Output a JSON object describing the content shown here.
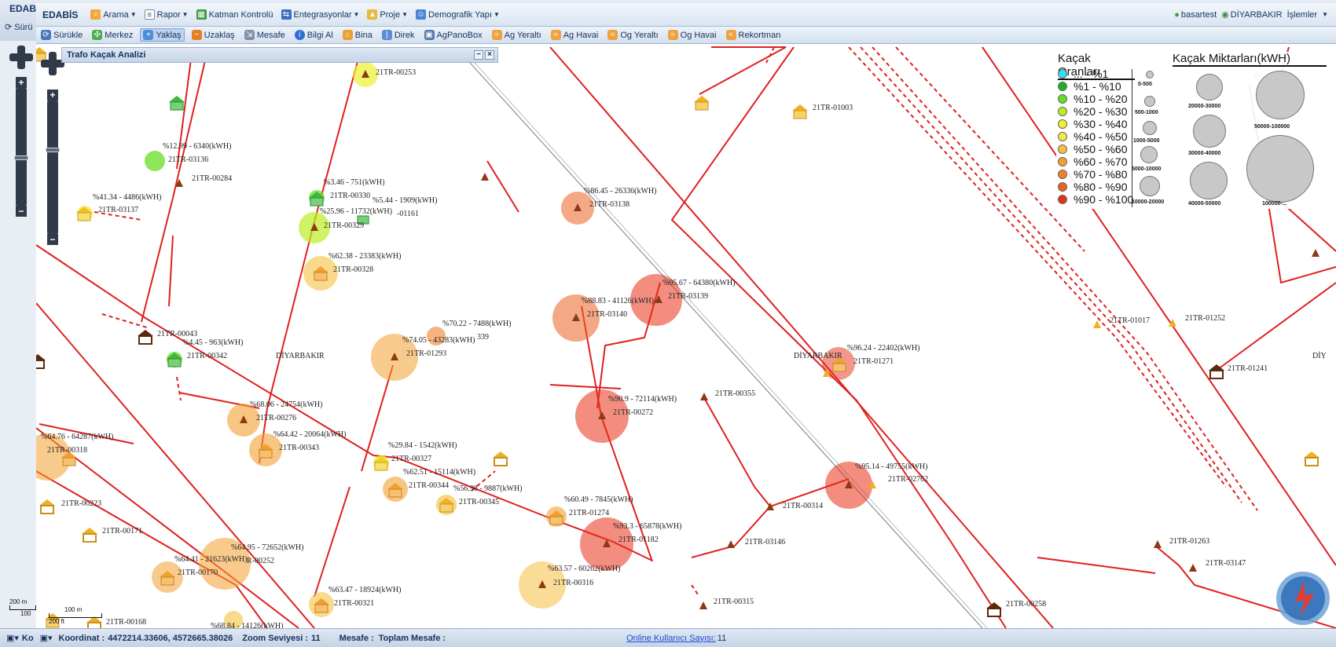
{
  "outer": {
    "title": "EDABİ",
    "tool": "Sürü",
    "status_prefix": "Ko"
  },
  "menubar": {
    "brand": "EDABİS",
    "items": [
      {
        "label": "Arama",
        "icon": "search-icon"
      },
      {
        "label": "Rapor",
        "icon": "report-icon"
      },
      {
        "label": "Katman Kontrolü",
        "icon": "layers-icon"
      },
      {
        "label": "Entegrasyonlar",
        "icon": "integration-icon"
      },
      {
        "label": "Proje",
        "icon": "project-icon"
      },
      {
        "label": "Demografik Yapı",
        "icon": "people-icon"
      }
    ],
    "user": "basartest",
    "region": "DİYARBAKIR",
    "actions": "İşlemler"
  },
  "toolbar": {
    "items": [
      {
        "label": "Sürükle",
        "icon": "drag-icon"
      },
      {
        "label": "Merkez",
        "icon": "center-icon"
      },
      {
        "label": "Yaklaş",
        "icon": "zoom-in-icon",
        "active": true
      },
      {
        "label": "Uzaklaş",
        "icon": "zoom-out-icon"
      },
      {
        "label": "Mesafe",
        "icon": "measure-icon"
      },
      {
        "label": "Bilgi Al",
        "icon": "info-icon"
      },
      {
        "label": "Bina",
        "icon": "building-icon"
      },
      {
        "label": "Direk",
        "icon": "pole-icon"
      },
      {
        "label": "AgPanoBox",
        "icon": "panel-box-icon"
      },
      {
        "label": "Ag Yeraltı",
        "icon": "lv-underground-icon"
      },
      {
        "label": "Ag Havai",
        "icon": "lv-overhead-icon"
      },
      {
        "label": "Og Yeraltı",
        "icon": "mv-underground-icon"
      },
      {
        "label": "Og Havai",
        "icon": "mv-overhead-icon"
      },
      {
        "label": "Rekortman",
        "icon": "record-icon"
      }
    ]
  },
  "panel": {
    "title": "Trafo Kaçak Analizi"
  },
  "legend": {
    "rates_title": "Kaçak Oranları",
    "amounts_title": "Kaçak Miktarları(kWH)",
    "rates": [
      {
        "label": "... - %1",
        "color": "#33e0f0"
      },
      {
        "label": "%1 - %10",
        "color": "#1bb51b"
      },
      {
        "label": "%10 - %20",
        "color": "#66dd22"
      },
      {
        "label": "%20 - %30",
        "color": "#bbee22"
      },
      {
        "label": "%30 - %40",
        "color": "#eef030"
      },
      {
        "label": "%40 - %50",
        "color": "#f7e84a"
      },
      {
        "label": "%50 - %60",
        "color": "#f5c040"
      },
      {
        "label": "%60 - %70",
        "color": "#f3a030"
      },
      {
        "label": "%70 - %80",
        "color": "#f0802a"
      },
      {
        "label": "%80 - %90",
        "color": "#ec6020"
      },
      {
        "label": "%90 - %100",
        "color": "#e83018"
      }
    ],
    "sizes": [
      "0-500",
      "500-1000",
      "1000-5000",
      "5000-10000",
      "10000-20000",
      "20000-30000",
      "30000-40000",
      "40000-50000",
      "50000-100000",
      "100000-..."
    ]
  },
  "map_labels": [
    {
      "text": "21TR-00253",
      "id": "trafo-21tr-00253"
    },
    {
      "text": "21TR-01003",
      "id": "trafo-21tr-01003"
    },
    {
      "text": "%12.99 - 6340(kWH)",
      "id": "leak-00136"
    },
    {
      "text": "21TR-03136",
      "id": "trafo-21tr-03136"
    },
    {
      "text": "21TR-00284",
      "id": "trafo-21tr-00284"
    },
    {
      "text": "%41.34 - 4486(kWH)",
      "id": "leak-03137"
    },
    {
      "text": "21TR-03137",
      "id": "trafo-21tr-03137"
    },
    {
      "text": "%3.46 - 751(kWH)",
      "id": "leak-00330"
    },
    {
      "text": "21TR-00330",
      "id": "trafo-21tr-00330"
    },
    {
      "text": "%5.44 - 1909(kWH)",
      "id": "leak-01161"
    },
    {
      "text": "%25.96 - 11732(kWH)",
      "id": "leak-00329"
    },
    {
      "text": "-01161",
      "id": "trafo-01161"
    },
    {
      "text": "21TR-00329",
      "id": "trafo-21tr-00329"
    },
    {
      "text": "%86.45 - 26336(kWH)",
      "id": "leak-03138"
    },
    {
      "text": "21TR-03138",
      "id": "trafo-21tr-03138"
    },
    {
      "text": "%62.38 - 23383(kWH)",
      "id": "leak-00328"
    },
    {
      "text": "21TR-00328",
      "id": "trafo-21tr-00328"
    },
    {
      "text": "%95.67 - 64380(kWH)",
      "id": "leak-03139"
    },
    {
      "text": "21TR-03139",
      "id": "trafo-21tr-03139"
    },
    {
      "text": "%88.83 - 41126(kWH)",
      "id": "leak-03140"
    },
    {
      "text": "21TR-03140",
      "id": "trafo-21tr-03140"
    },
    {
      "text": "21TR-00043",
      "id": "trafo-21tr-00043"
    },
    {
      "text": "%4.45 - 963(kWH)",
      "id": "leak-00342"
    },
    {
      "text": "21TR-00342",
      "id": "trafo-21tr-00342"
    },
    {
      "text": "DİYARBAKIR",
      "id": "city-1"
    },
    {
      "text": "%70.22 - 7488(kWH)",
      "id": "leak-00339"
    },
    {
      "text": "%74.05 - 43283(kWH)",
      "id": "leak-01293"
    },
    {
      "text": "339",
      "id": "trafo-00339"
    },
    {
      "text": "21TR-01293",
      "id": "trafo-21tr-01293"
    },
    {
      "text": "21TR-01017",
      "id": "trafo-21tr-01017"
    },
    {
      "text": "21TR-01252",
      "id": "trafo-21tr-01252"
    },
    {
      "text": "DİYARBAKIR",
      "id": "city-2"
    },
    {
      "text": "%96.24 - 22402(kWH)",
      "id": "leak-01271"
    },
    {
      "text": "21TR-01271",
      "id": "trafo-21tr-01271"
    },
    {
      "text": "21TR-01241",
      "id": "trafo-21tr-01241"
    },
    {
      "text": "DİY",
      "id": "city-3"
    },
    {
      "text": "%90.9 - 72114(kWH)",
      "id": "leak-00272"
    },
    {
      "text": "21TR-00272",
      "id": "trafo-21tr-00272"
    },
    {
      "text": "21TR-00355",
      "id": "trafo-21tr-00355"
    },
    {
      "text": "%68.06 - 24754(kWH)",
      "id": "leak-00276"
    },
    {
      "text": "21TR-00276",
      "id": "trafo-21tr-00276"
    },
    {
      "text": "%64.76 - 64287(kWH)",
      "id": "leak-00318"
    },
    {
      "text": "21TR-00318",
      "id": "trafo-21tr-00318"
    },
    {
      "text": "%64.42 - 20064(kWH)",
      "id": "leak-00343"
    },
    {
      "text": "21TR-00343",
      "id": "trafo-21tr-00343"
    },
    {
      "text": "%29.84 - 1542(kWH)",
      "id": "leak-00327"
    },
    {
      "text": "21TR-00327",
      "id": "trafo-21tr-00327"
    },
    {
      "text": "%62.51 - 15114(kWH)",
      "id": "leak-00344"
    },
    {
      "text": "21TR-00344",
      "id": "trafo-21tr-00344"
    },
    {
      "text": "%56.98 - 9887(kWH)",
      "id": "leak-00345"
    },
    {
      "text": "21TR-00345",
      "id": "trafo-21tr-00345"
    },
    {
      "text": "%95.14 - 49755(kWH)",
      "id": "leak-02762"
    },
    {
      "text": "21TR-02762",
      "id": "trafo-21tr-02762"
    },
    {
      "text": "21TR-00223",
      "id": "trafo-21tr-00223"
    },
    {
      "text": "%60.49 - 7845(kWH)",
      "id": "leak-01274"
    },
    {
      "text": "21TR-01274",
      "id": "trafo-21tr-01274"
    },
    {
      "text": "21TR-00314",
      "id": "trafo-21tr-00314"
    },
    {
      "text": "21TR-00171",
      "id": "trafo-21tr-00171"
    },
    {
      "text": "%93.3 - 65878(kWH)",
      "id": "leak-01182"
    },
    {
      "text": "21TR-01182",
      "id": "trafo-21tr-01182"
    },
    {
      "text": "21TR-03146",
      "id": "trafo-21tr-03146"
    },
    {
      "text": "21TR-01263",
      "id": "trafo-21tr-01263"
    },
    {
      "text": "%64.95 - 72652(kWH)",
      "id": "leak-00252"
    },
    {
      "text": "%64.41 - 21623(kWH)",
      "id": "leak-00170"
    },
    {
      "text": "R-00252",
      "id": "trafo-00252"
    },
    {
      "text": "21TR-00170",
      "id": "trafo-21tr-00170"
    },
    {
      "text": "%63.57 - 60262(kWH)",
      "id": "leak-00316"
    },
    {
      "text": "21TR-00316",
      "id": "trafo-21tr-00316"
    },
    {
      "text": "21TR-03147",
      "id": "trafo-21tr-03147"
    },
    {
      "text": "%63.47 - 18924(kWH)",
      "id": "leak-00321"
    },
    {
      "text": "21TR-00321",
      "id": "trafo-21tr-00321"
    },
    {
      "text": "21TR-00315",
      "id": "trafo-21tr-00315"
    },
    {
      "text": "21TR-00258",
      "id": "trafo-21tr-00258"
    },
    {
      "text": "21TR-00168",
      "id": "trafo-21tr-00168"
    },
    {
      "text": "%68.84 - 14126(kWH)",
      "id": "leak-00168"
    }
  ],
  "scale": {
    "top_m": "100 m",
    "top_ft": "200 ft",
    "outer_m": "200 m",
    "outer_ft": "100"
  },
  "status": {
    "coord_label": "Koordinat :",
    "coord_value": "4472214.33606, 4572665.38026",
    "zoom_label": "Zoom Seviyesi :",
    "zoom_value": "11",
    "distance_label": "Mesafe :",
    "total_label": "Toplam Mesafe :",
    "online_label": "Online Kullanıcı Sayısı:",
    "online_value": "11"
  }
}
